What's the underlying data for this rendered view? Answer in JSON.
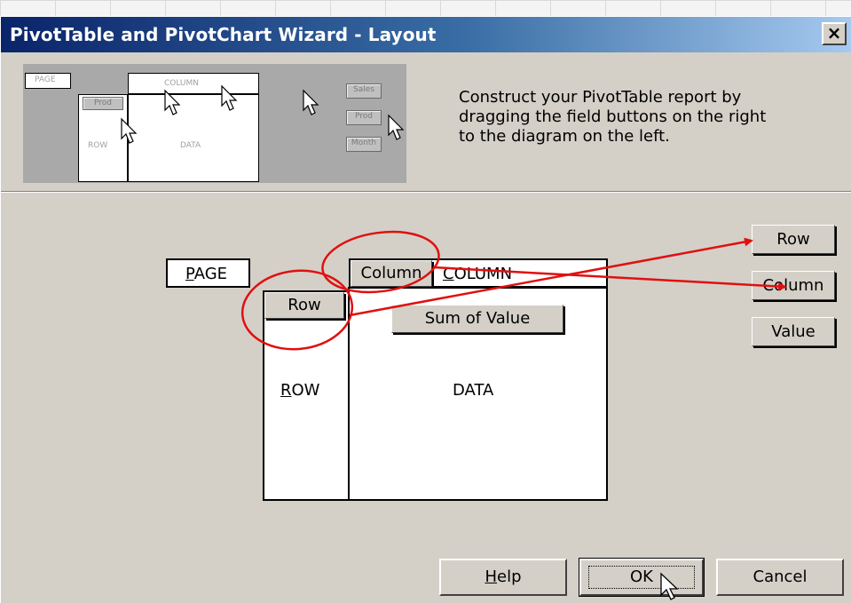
{
  "dialog": {
    "title": "PivotTable and PivotChart Wizard - Layout",
    "close_glyph": "×",
    "instructions": "Construct your PivotTable report by\ndragging the field buttons on the right\nto the diagram on the left."
  },
  "thumbnail": {
    "page": "PAGE",
    "column": "COLUMN",
    "row": "ROW",
    "data": "DATA",
    "row_field": "Prod",
    "fields": [
      "Sales",
      "Prod",
      "Month"
    ]
  },
  "layout": {
    "page_prefix": "P",
    "page_rest": "AGE",
    "column_prefix": "C",
    "column_rest": "OLUMN",
    "row_prefix": "R",
    "row_rest": "OW",
    "data_label": "DATA",
    "column_field": "Column",
    "row_field": "Row",
    "data_field": "Sum of Value"
  },
  "fields": [
    {
      "label": "Row"
    },
    {
      "label": "Column"
    },
    {
      "label": "Value"
    }
  ],
  "buttons": {
    "help_prefix": "H",
    "help_rest": "elp",
    "ok": "OK",
    "cancel": "Cancel"
  },
  "colors": {
    "title_start": "#0a246a",
    "title_end": "#a6caf0",
    "dialog_face": "#d4d0c8",
    "annotation": "#e01010"
  }
}
